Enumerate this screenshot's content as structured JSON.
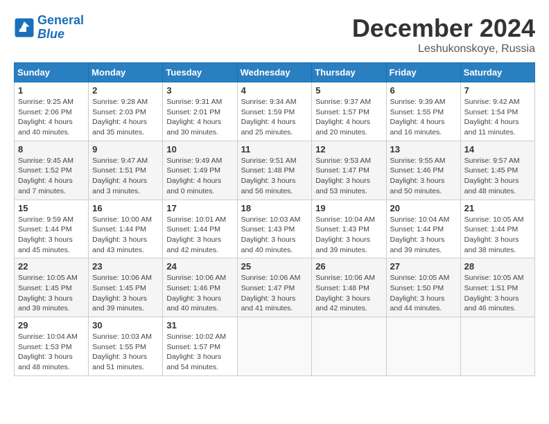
{
  "header": {
    "logo_line1": "General",
    "logo_line2": "Blue",
    "title": "December 2024",
    "subtitle": "Leshukonskoye, Russia"
  },
  "weekdays": [
    "Sunday",
    "Monday",
    "Tuesday",
    "Wednesday",
    "Thursday",
    "Friday",
    "Saturday"
  ],
  "weeks": [
    [
      {
        "day": "1",
        "sunrise": "9:25 AM",
        "sunset": "2:06 PM",
        "daylight": "4 hours and 40 minutes."
      },
      {
        "day": "2",
        "sunrise": "9:28 AM",
        "sunset": "2:03 PM",
        "daylight": "4 hours and 35 minutes."
      },
      {
        "day": "3",
        "sunrise": "9:31 AM",
        "sunset": "2:01 PM",
        "daylight": "4 hours and 30 minutes."
      },
      {
        "day": "4",
        "sunrise": "9:34 AM",
        "sunset": "1:59 PM",
        "daylight": "4 hours and 25 minutes."
      },
      {
        "day": "5",
        "sunrise": "9:37 AM",
        "sunset": "1:57 PM",
        "daylight": "4 hours and 20 minutes."
      },
      {
        "day": "6",
        "sunrise": "9:39 AM",
        "sunset": "1:55 PM",
        "daylight": "4 hours and 16 minutes."
      },
      {
        "day": "7",
        "sunrise": "9:42 AM",
        "sunset": "1:54 PM",
        "daylight": "4 hours and 11 minutes."
      }
    ],
    [
      {
        "day": "8",
        "sunrise": "9:45 AM",
        "sunset": "1:52 PM",
        "daylight": "4 hours and 7 minutes."
      },
      {
        "day": "9",
        "sunrise": "9:47 AM",
        "sunset": "1:51 PM",
        "daylight": "4 hours and 3 minutes."
      },
      {
        "day": "10",
        "sunrise": "9:49 AM",
        "sunset": "1:49 PM",
        "daylight": "4 hours and 0 minutes."
      },
      {
        "day": "11",
        "sunrise": "9:51 AM",
        "sunset": "1:48 PM",
        "daylight": "3 hours and 56 minutes."
      },
      {
        "day": "12",
        "sunrise": "9:53 AM",
        "sunset": "1:47 PM",
        "daylight": "3 hours and 53 minutes."
      },
      {
        "day": "13",
        "sunrise": "9:55 AM",
        "sunset": "1:46 PM",
        "daylight": "3 hours and 50 minutes."
      },
      {
        "day": "14",
        "sunrise": "9:57 AM",
        "sunset": "1:45 PM",
        "daylight": "3 hours and 48 minutes."
      }
    ],
    [
      {
        "day": "15",
        "sunrise": "9:59 AM",
        "sunset": "1:44 PM",
        "daylight": "3 hours and 45 minutes."
      },
      {
        "day": "16",
        "sunrise": "10:00 AM",
        "sunset": "1:44 PM",
        "daylight": "3 hours and 43 minutes."
      },
      {
        "day": "17",
        "sunrise": "10:01 AM",
        "sunset": "1:44 PM",
        "daylight": "3 hours and 42 minutes."
      },
      {
        "day": "18",
        "sunrise": "10:03 AM",
        "sunset": "1:43 PM",
        "daylight": "3 hours and 40 minutes."
      },
      {
        "day": "19",
        "sunrise": "10:04 AM",
        "sunset": "1:43 PM",
        "daylight": "3 hours and 39 minutes."
      },
      {
        "day": "20",
        "sunrise": "10:04 AM",
        "sunset": "1:44 PM",
        "daylight": "3 hours and 39 minutes."
      },
      {
        "day": "21",
        "sunrise": "10:05 AM",
        "sunset": "1:44 PM",
        "daylight": "3 hours and 38 minutes."
      }
    ],
    [
      {
        "day": "22",
        "sunrise": "10:05 AM",
        "sunset": "1:45 PM",
        "daylight": "3 hours and 39 minutes."
      },
      {
        "day": "23",
        "sunrise": "10:06 AM",
        "sunset": "1:45 PM",
        "daylight": "3 hours and 39 minutes."
      },
      {
        "day": "24",
        "sunrise": "10:06 AM",
        "sunset": "1:46 PM",
        "daylight": "3 hours and 40 minutes."
      },
      {
        "day": "25",
        "sunrise": "10:06 AM",
        "sunset": "1:47 PM",
        "daylight": "3 hours and 41 minutes."
      },
      {
        "day": "26",
        "sunrise": "10:06 AM",
        "sunset": "1:48 PM",
        "daylight": "3 hours and 42 minutes."
      },
      {
        "day": "27",
        "sunrise": "10:05 AM",
        "sunset": "1:50 PM",
        "daylight": "3 hours and 44 minutes."
      },
      {
        "day": "28",
        "sunrise": "10:05 AM",
        "sunset": "1:51 PM",
        "daylight": "3 hours and 46 minutes."
      }
    ],
    [
      {
        "day": "29",
        "sunrise": "10:04 AM",
        "sunset": "1:53 PM",
        "daylight": "3 hours and 48 minutes."
      },
      {
        "day": "30",
        "sunrise": "10:03 AM",
        "sunset": "1:55 PM",
        "daylight": "3 hours and 51 minutes."
      },
      {
        "day": "31",
        "sunrise": "10:02 AM",
        "sunset": "1:57 PM",
        "daylight": "3 hours and 54 minutes."
      },
      null,
      null,
      null,
      null
    ]
  ]
}
